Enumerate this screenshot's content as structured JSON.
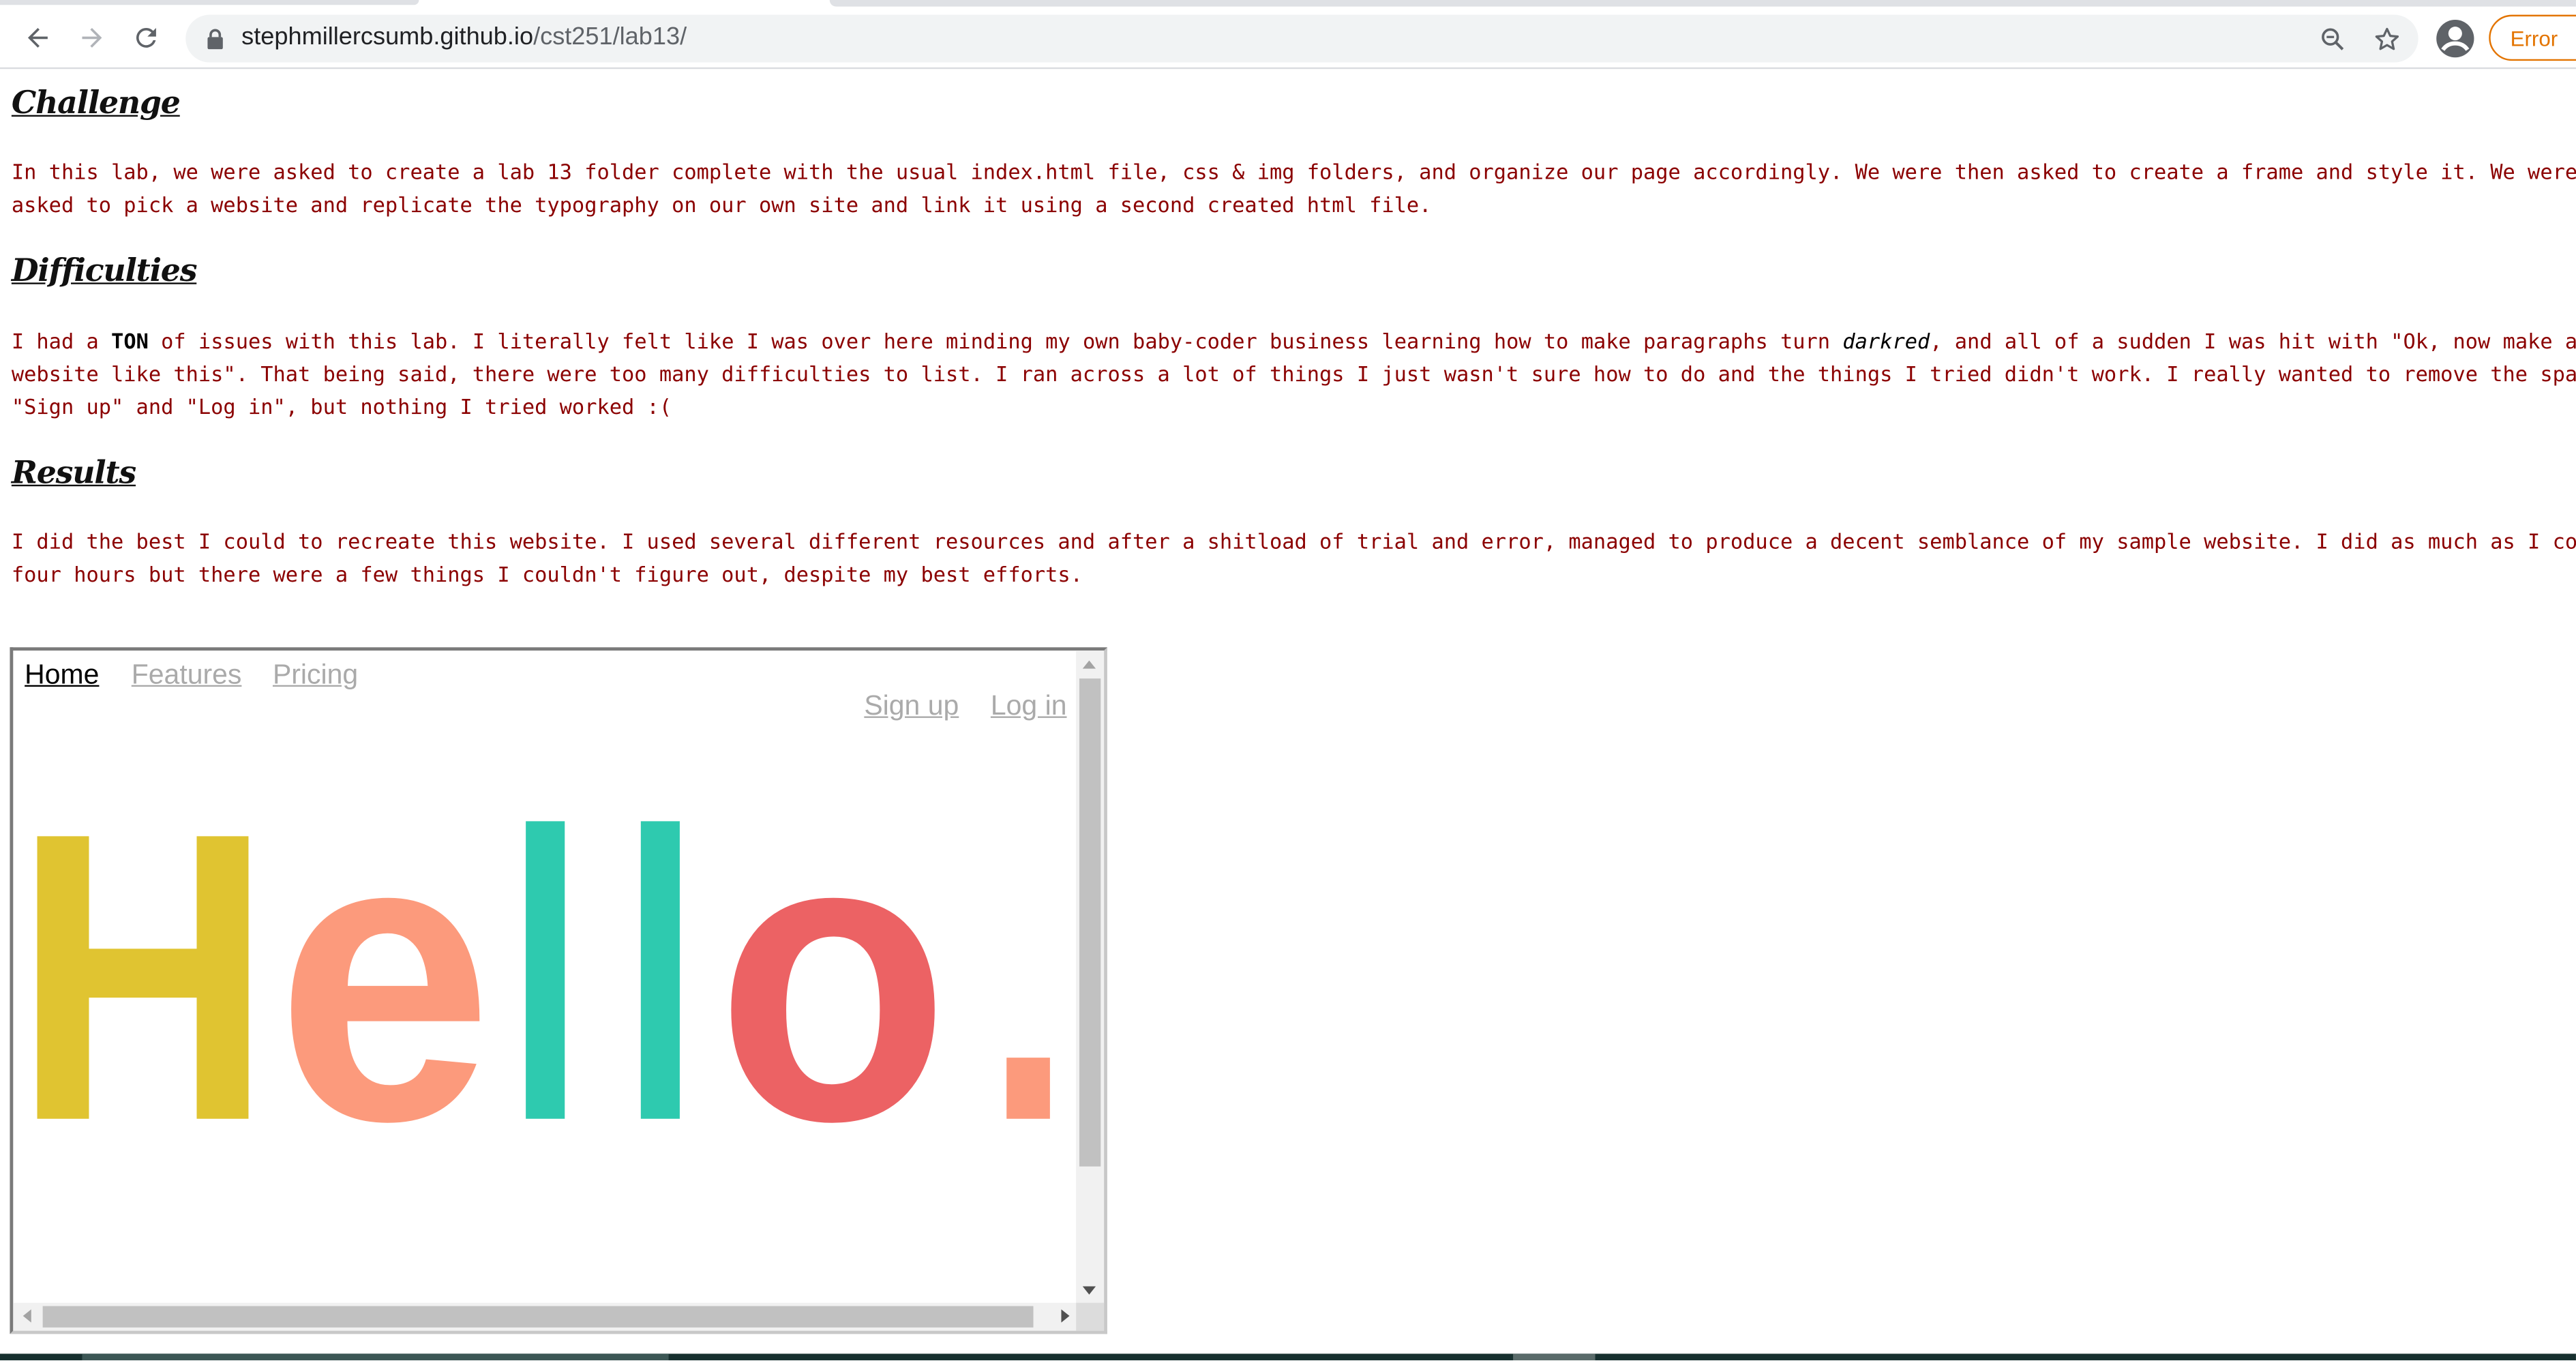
{
  "browser": {
    "url_host": "stephmillercsumb.github.io",
    "url_path": "/cst251/lab13/",
    "error_label": "Error"
  },
  "sections": {
    "challenge": {
      "heading": "Challenge",
      "line1": "In this lab, we were asked to create a lab 13 folder complete with the usual index.html file, css & img folders, and organize our page accordingly. We were then asked to create a frame and style it. We were then",
      "line2": "asked to pick a website and replicate the typography on our own site and link it using a second created html file."
    },
    "difficulties": {
      "heading": "Difficulties",
      "line1_a": "I had a ",
      "line1_bold": "TON",
      "line1_b": " of issues with this lab. I literally felt like I was over here minding my own baby-coder business learning how to make paragraphs turn ",
      "line1_italic": "darkred",
      "line1_c": ", and all of a sudden I was hit with \"Ok, now make a cool",
      "line2": "website like this\". That being said, there were too many difficulties to list. I ran across a lot of things I just wasn't sure how to do and the things I tried didn't work. I really wanted to remove the space above",
      "line3": "\"Sign up\" and \"Log in\", but nothing I tried worked :("
    },
    "results": {
      "heading": "Results",
      "line1": "I did the best I could to recreate this website. I used several different resources and after a shitload of trial and error, managed to produce a decent semblance of my sample website. I did as much as I could in",
      "line2": "four hours but there were a few things I couldn't figure out, despite my best efforts."
    }
  },
  "iframe": {
    "nav": [
      "Home",
      "Features",
      "Pricing"
    ],
    "auth": [
      "Sign up",
      "Log in"
    ],
    "hello_letters": [
      "H",
      "e",
      "l",
      "l",
      "o",
      "."
    ],
    "hello_colors": [
      "#e0c431",
      "#fc9a7c",
      "#2ecaaf",
      "#2ecaaf",
      "#ec6264",
      "#fc9a7c"
    ]
  },
  "colors": {
    "paragraph_text": "#8b0000",
    "error_accent": "#e37400"
  }
}
